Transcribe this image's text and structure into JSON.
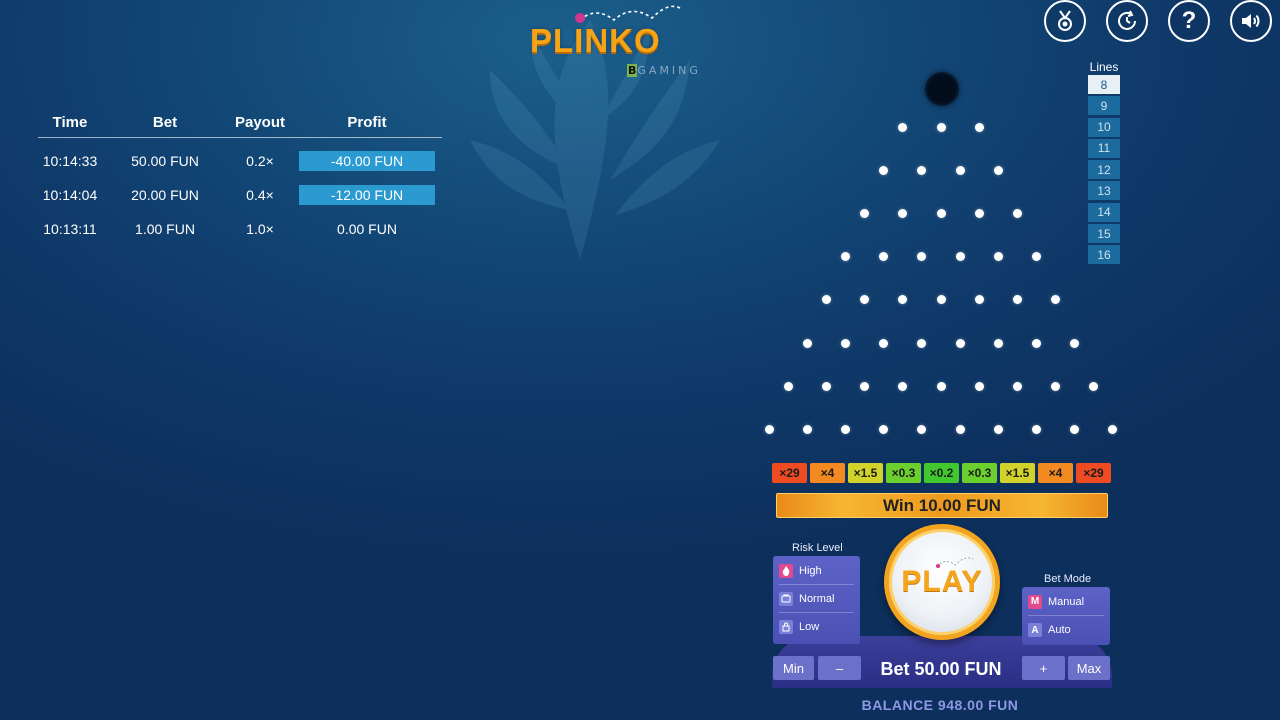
{
  "logo": {
    "title": "PLINKO",
    "brand_b": "B",
    "brand_rest": "GAMING"
  },
  "top_icons": [
    "medal-icon",
    "history-icon",
    "help-icon",
    "sound-icon"
  ],
  "history": {
    "headers": {
      "time": "Time",
      "bet": "Bet",
      "payout": "Payout",
      "profit": "Profit"
    },
    "rows": [
      {
        "time": "10:14:33",
        "bet": "50.00 FUN",
        "payout": "0.2×",
        "profit": "-40.00 FUN"
      },
      {
        "time": "10:14:04",
        "bet": "20.00 FUN",
        "payout": "0.4×",
        "profit": "-12.00 FUN"
      },
      {
        "time": "10:13:11",
        "bet": "1.00 FUN",
        "payout": "1.0×",
        "profit": "0.00 FUN"
      }
    ]
  },
  "lines": {
    "label": "Lines",
    "options": [
      "8",
      "9",
      "10",
      "11",
      "12",
      "13",
      "14",
      "15",
      "16"
    ],
    "selected": "8"
  },
  "multipliers": [
    {
      "label": "×29",
      "color": "#ef4b23"
    },
    {
      "label": "×4",
      "color": "#f38a21"
    },
    {
      "label": "×1.5",
      "color": "#d2d32a"
    },
    {
      "label": "×0.3",
      "color": "#6bd02e"
    },
    {
      "label": "×0.2",
      "color": "#41c82f"
    },
    {
      "label": "×0.3",
      "color": "#6bd02e"
    },
    {
      "label": "×1.5",
      "color": "#d2d32a"
    },
    {
      "label": "×4",
      "color": "#f38a21"
    },
    {
      "label": "×29",
      "color": "#ef4b23"
    }
  ],
  "win_banner": "Win 10.00 FUN",
  "risk": {
    "title": "Risk Level",
    "options": [
      {
        "label": "High",
        "icon": "flame-icon",
        "selected": true
      },
      {
        "label": "Normal",
        "icon": "cup-icon",
        "selected": false
      },
      {
        "label": "Low",
        "icon": "lock-icon",
        "selected": false
      }
    ]
  },
  "play_label": "PLAY",
  "bet_mode": {
    "title": "Bet Mode",
    "options": [
      {
        "label": "Manual",
        "key": "M",
        "selected": true
      },
      {
        "label": "Auto",
        "key": "A",
        "selected": false
      }
    ]
  },
  "bet": {
    "min": "Min",
    "minus": "–",
    "label": "Bet 50.00 FUN",
    "plus": "+",
    "max": "Max"
  },
  "balance": "BALANCE 948.00 FUN",
  "colors": {
    "accent": "#f4a51c",
    "loss_bar": "#2a9ad0",
    "panel": "#5d63c6"
  }
}
